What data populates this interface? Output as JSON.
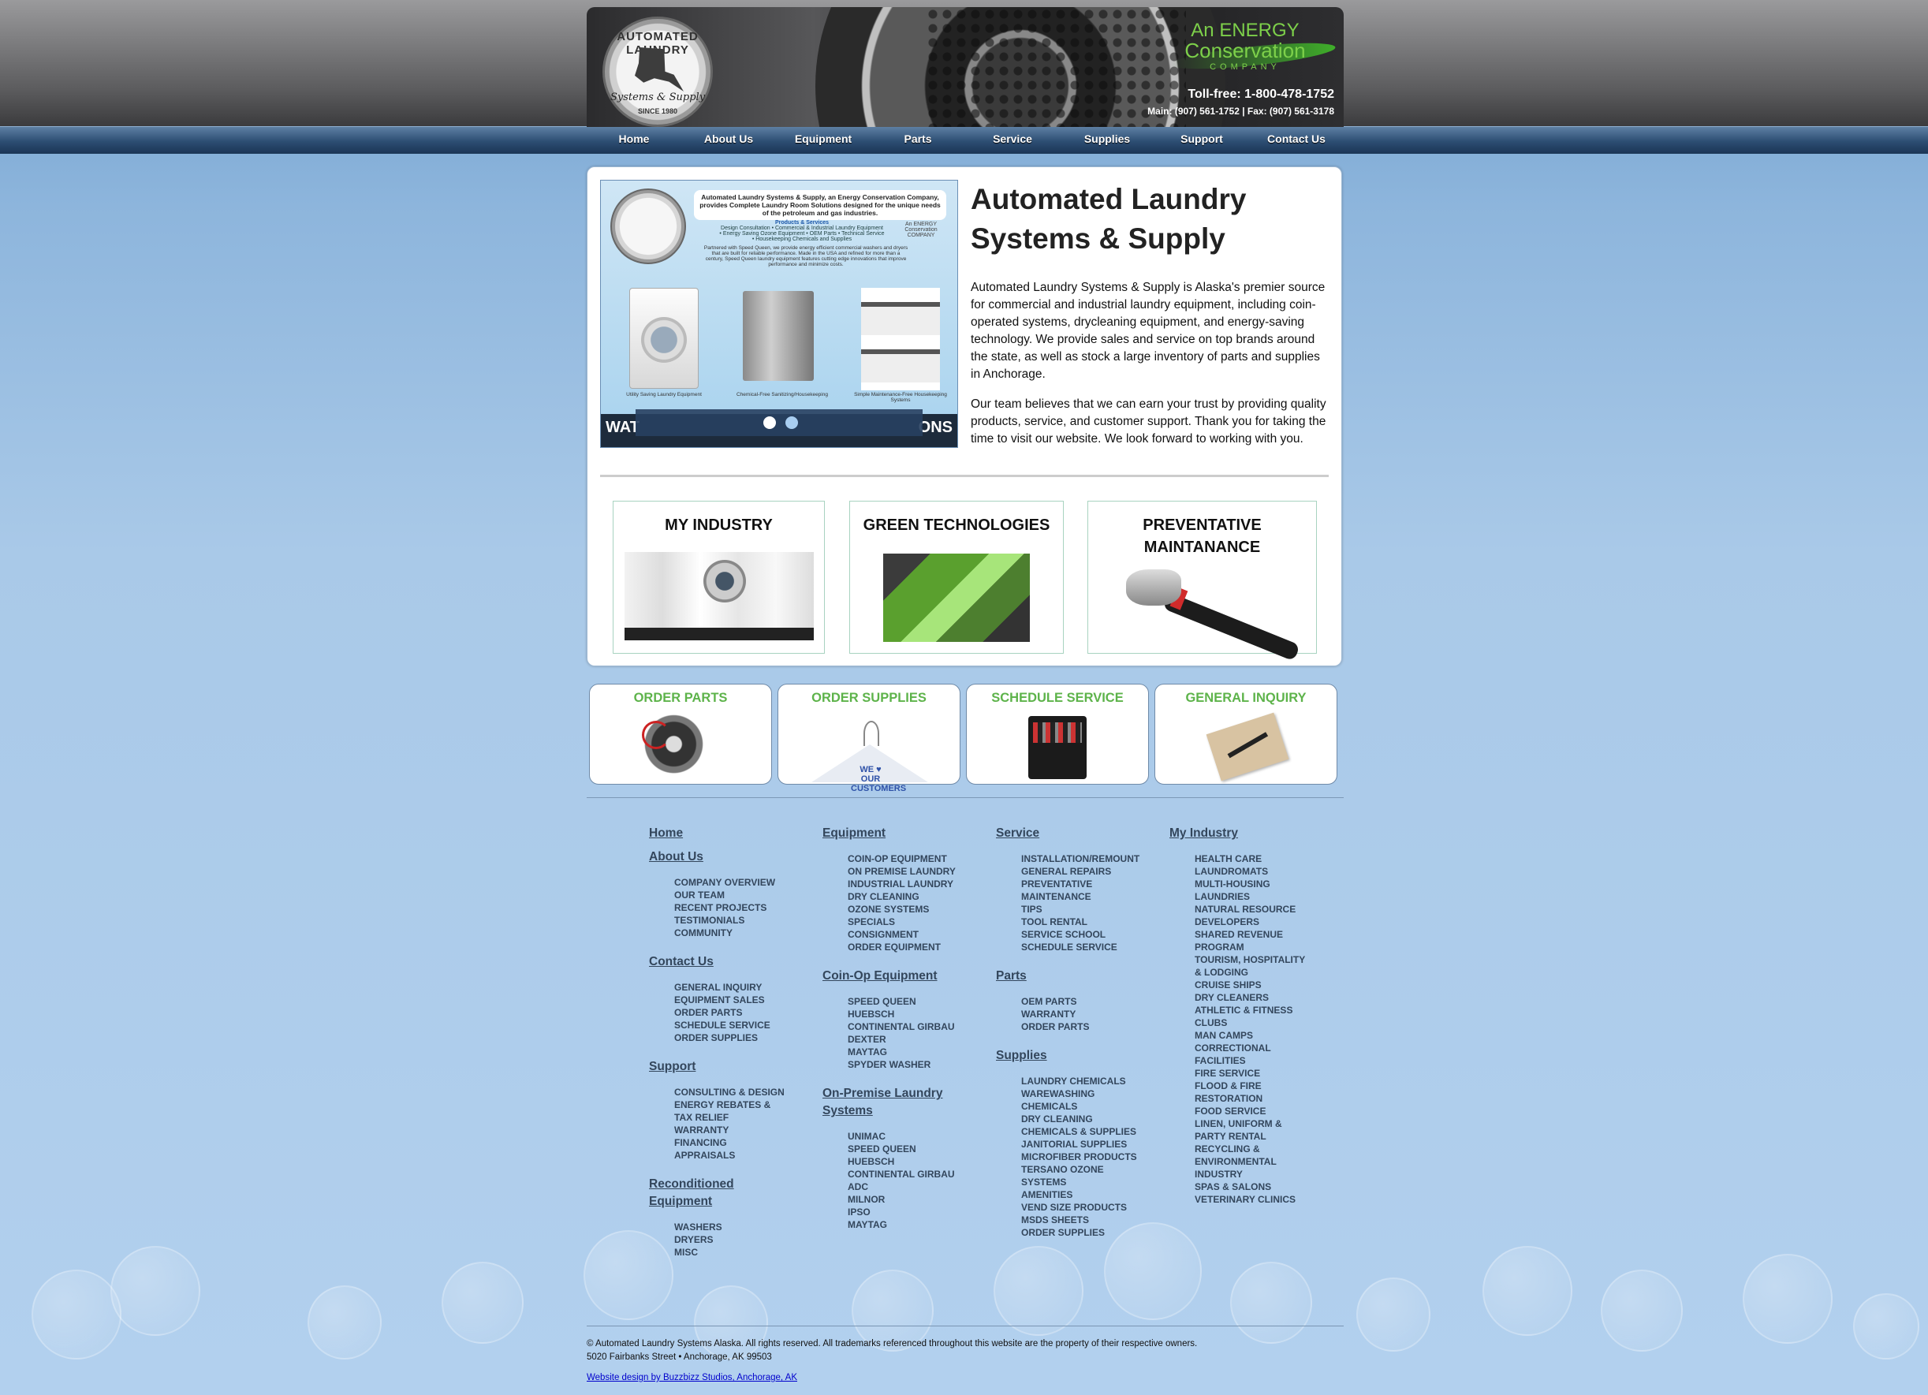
{
  "header": {
    "seal": {
      "top": "AUTOMATED LAUNDRY",
      "script": "Systems & Supply",
      "since": "SINCE 1980"
    },
    "ecc": {
      "line1": "An ENERGY",
      "line2": "Conservation",
      "line3": "COMPANY"
    },
    "tollfree": "Toll-free: 1-800-478-1752",
    "mainline": "Main: (907) 561-1752 | Fax: (907) 561-3178"
  },
  "nav": [
    "Home",
    "About Us",
    "Equipment",
    "Parts",
    "Service",
    "Supplies",
    "Support",
    "Contact Us"
  ],
  "slider": {
    "title": "Automated Laundry Systems & Supply, an Energy Conservation Company, provides Complete Laundry Room Solutions designed for the unique needs of the petroleum and gas industries.",
    "products_heading": "Products & Services",
    "products_text": "Design Consultation • Commercial & Industrial Laundry Equipment • Energy Saving Ozone Equipment • OEM Parts • Technical Service • Housekeeping Chemicals and Supplies",
    "para": "Partnered with Speed Queen, we provide energy efficient commercial washers and dryers that are built for reliable performance. Made in the USA and refined for more than a century, Speed Queen laundry equipment features cutting edge innovations that improve performance and minimize costs.",
    "ecc_small": "An ENERGY Conservation COMPANY",
    "cap1": "Utility Saving Laundry Equipment",
    "cap2": "Chemical-Free Sanitizing/Housekeeping",
    "cap3": "Simple Maintenance-Free Housekeeping Systems",
    "bar_left": "WAT",
    "bar_right": "ONS"
  },
  "intro": {
    "title": "Automated Laundry Systems & Supply",
    "p1": "Automated Laundry Systems & Supply is Alaska's premier source for commercial and industrial laundry equipment, including coin-operated systems, drycleaning equipment, and energy-saving technology. We provide sales and service on top brands around the state, as well as stock a large inventory of parts and supplies in Anchorage.",
    "p2": "Our team believes that we can earn your trust by providing quality products, service, and customer support. Thank you for taking the time to visit our website. We look forward to working with you."
  },
  "cards": [
    "MY INDUSTRY",
    "GREEN TECHNOLOGIES",
    "PREVENTATIVE MAINTANANCE"
  ],
  "buttons": [
    "ORDER PARTS",
    "ORDER SUPPLIES",
    "SCHEDULE SERVICE",
    "GENERAL INQUIRY"
  ],
  "hanger_text": "WE ♥ OUR CUSTOMERS",
  "footer_nav": {
    "col1": {
      "home": "Home",
      "about": "About Us",
      "about_items": [
        "COMPANY OVERVIEW",
        "OUR TEAM",
        "RECENT PROJECTS",
        "TESTIMONIALS",
        "COMMUNITY"
      ],
      "contact": "Contact Us",
      "contact_items": [
        "GENERAL INQUIRY",
        "EQUIPMENT SALES",
        "ORDER PARTS",
        "SCHEDULE SERVICE",
        "ORDER SUPPLIES"
      ],
      "support": "Support",
      "support_items": [
        "CONSULTING & DESIGN",
        "ENERGY REBATES &",
        "TAX RELIEF",
        "WARRANTY",
        "FINANCING",
        "APPRAISALS"
      ],
      "recon": "Reconditioned Equipment",
      "recon_items": [
        "WASHERS",
        "DRYERS",
        "MISC"
      ]
    },
    "col2": {
      "equipment": "Equipment",
      "equipment_items": [
        "COIN-OP EQUIPMENT",
        "ON PREMISE LAUNDRY",
        "INDUSTRIAL LAUNDRY",
        "DRY CLEANING",
        "OZONE SYSTEMS",
        "SPECIALS",
        "CONSIGNMENT",
        "ORDER EQUIPMENT"
      ],
      "coinop": "Coin-Op Equipment",
      "coinop_items": [
        "SPEED QUEEN",
        "HUEBSCH",
        "CONTINENTAL GIRBAU",
        "DEXTER",
        "MAYTAG",
        "SPYDER WASHER"
      ],
      "onprem": "On-Premise Laundry Systems",
      "onprem_items": [
        "UNIMAC",
        "SPEED QUEEN",
        "HUEBSCH",
        "CONTINENTAL GIRBAU",
        "ADC",
        "MILNOR",
        "IPSO",
        "MAYTAG"
      ]
    },
    "col3": {
      "service": "Service",
      "service_items": [
        "INSTALLATION/REMOUNT",
        "GENERAL REPAIRS",
        "PREVENTATIVE",
        "MAINTENANCE",
        "TIPS",
        "TOOL RENTAL",
        "SERVICE SCHOOL",
        "SCHEDULE SERVICE"
      ],
      "parts": "Parts",
      "parts_items": [
        "OEM PARTS",
        "WARRANTY",
        "ORDER PARTS"
      ],
      "supplies": "Supplies",
      "supplies_items": [
        "LAUNDRY CHEMICALS",
        "WAREWASHING",
        "CHEMICALS",
        "DRY CLEANING",
        "CHEMICALS & SUPPLIES",
        "JANITORIAL SUPPLIES",
        "MICROFIBER PRODUCTS",
        "TERSANO OZONE",
        "SYSTEMS",
        "AMENITIES",
        "VEND SIZE PRODUCTS",
        "MSDS SHEETS",
        "ORDER SUPPLIES"
      ]
    },
    "col4": {
      "industry": "My Industry",
      "industry_items": [
        "HEALTH CARE",
        "LAUNDROMATS",
        "MULTI-HOUSING",
        "LAUNDRIES",
        "NATURAL RESOURCE",
        "DEVELOPERS",
        "SHARED REVENUE",
        "PROGRAM",
        "TOURISM, HOSPITALITY",
        "& LODGING",
        "CRUISE SHIPS",
        "DRY CLEANERS",
        "ATHLETIC & FITNESS",
        "CLUBS",
        "MAN CAMPS",
        "CORRECTIONAL",
        "FACILITIES",
        "FIRE SERVICE",
        "FLOOD & FIRE",
        "RESTORATION",
        "FOOD SERVICE",
        "LINEN, UNIFORM &",
        "PARTY RENTAL",
        "RECYCLING &",
        "ENVIRONMENTAL",
        "INDUSTRY",
        "SPAS & SALONS",
        "VETERINARY CLINICS"
      ]
    }
  },
  "footer": {
    "copyright": "© Automated Laundry Systems Alaska. All rights reserved. All trademarks referenced throughout this website are the property of their respective owners.",
    "address": "5020 Fairbanks Street • Anchorage, AK 99503",
    "credit": "Website design by Buzzbizz Studios, Anchorage, AK"
  }
}
